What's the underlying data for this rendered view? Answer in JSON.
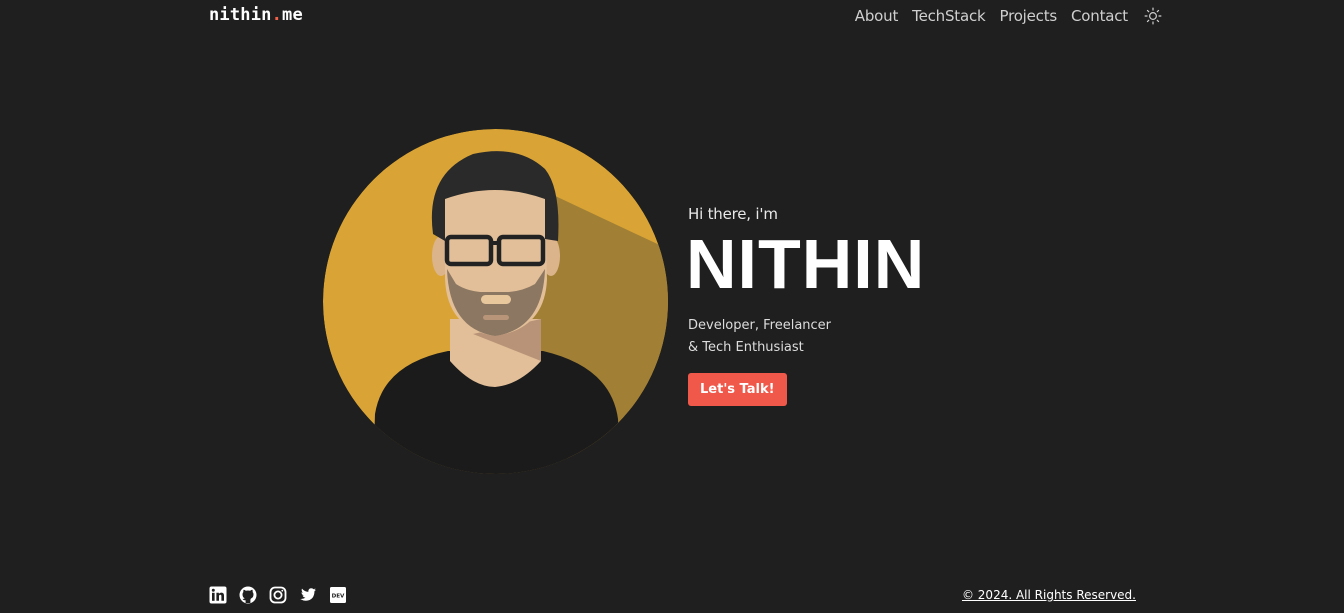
{
  "header": {
    "logo_main": "nithin",
    "logo_dot": ".",
    "logo_ext": "me",
    "nav": [
      {
        "label": "About"
      },
      {
        "label": "TechStack"
      },
      {
        "label": "Projects"
      },
      {
        "label": "Contact"
      }
    ],
    "theme_icon": "sun-icon"
  },
  "hero": {
    "greeting": "Hi there, i'm",
    "name": "NITHIN",
    "tagline_line1": "Developer, Freelancer",
    "tagline_line2": "& Tech Enthusiast",
    "cta_label": "Let's Talk!"
  },
  "footer": {
    "socials": [
      "linkedin-icon",
      "github-icon",
      "instagram-icon",
      "twitter-icon",
      "dev-icon"
    ],
    "copyright": "© 2024. All Rights Reserved."
  },
  "colors": {
    "background": "#1f1f1f",
    "accent": "#f0584a",
    "avatar_circle": "#d9a435"
  }
}
